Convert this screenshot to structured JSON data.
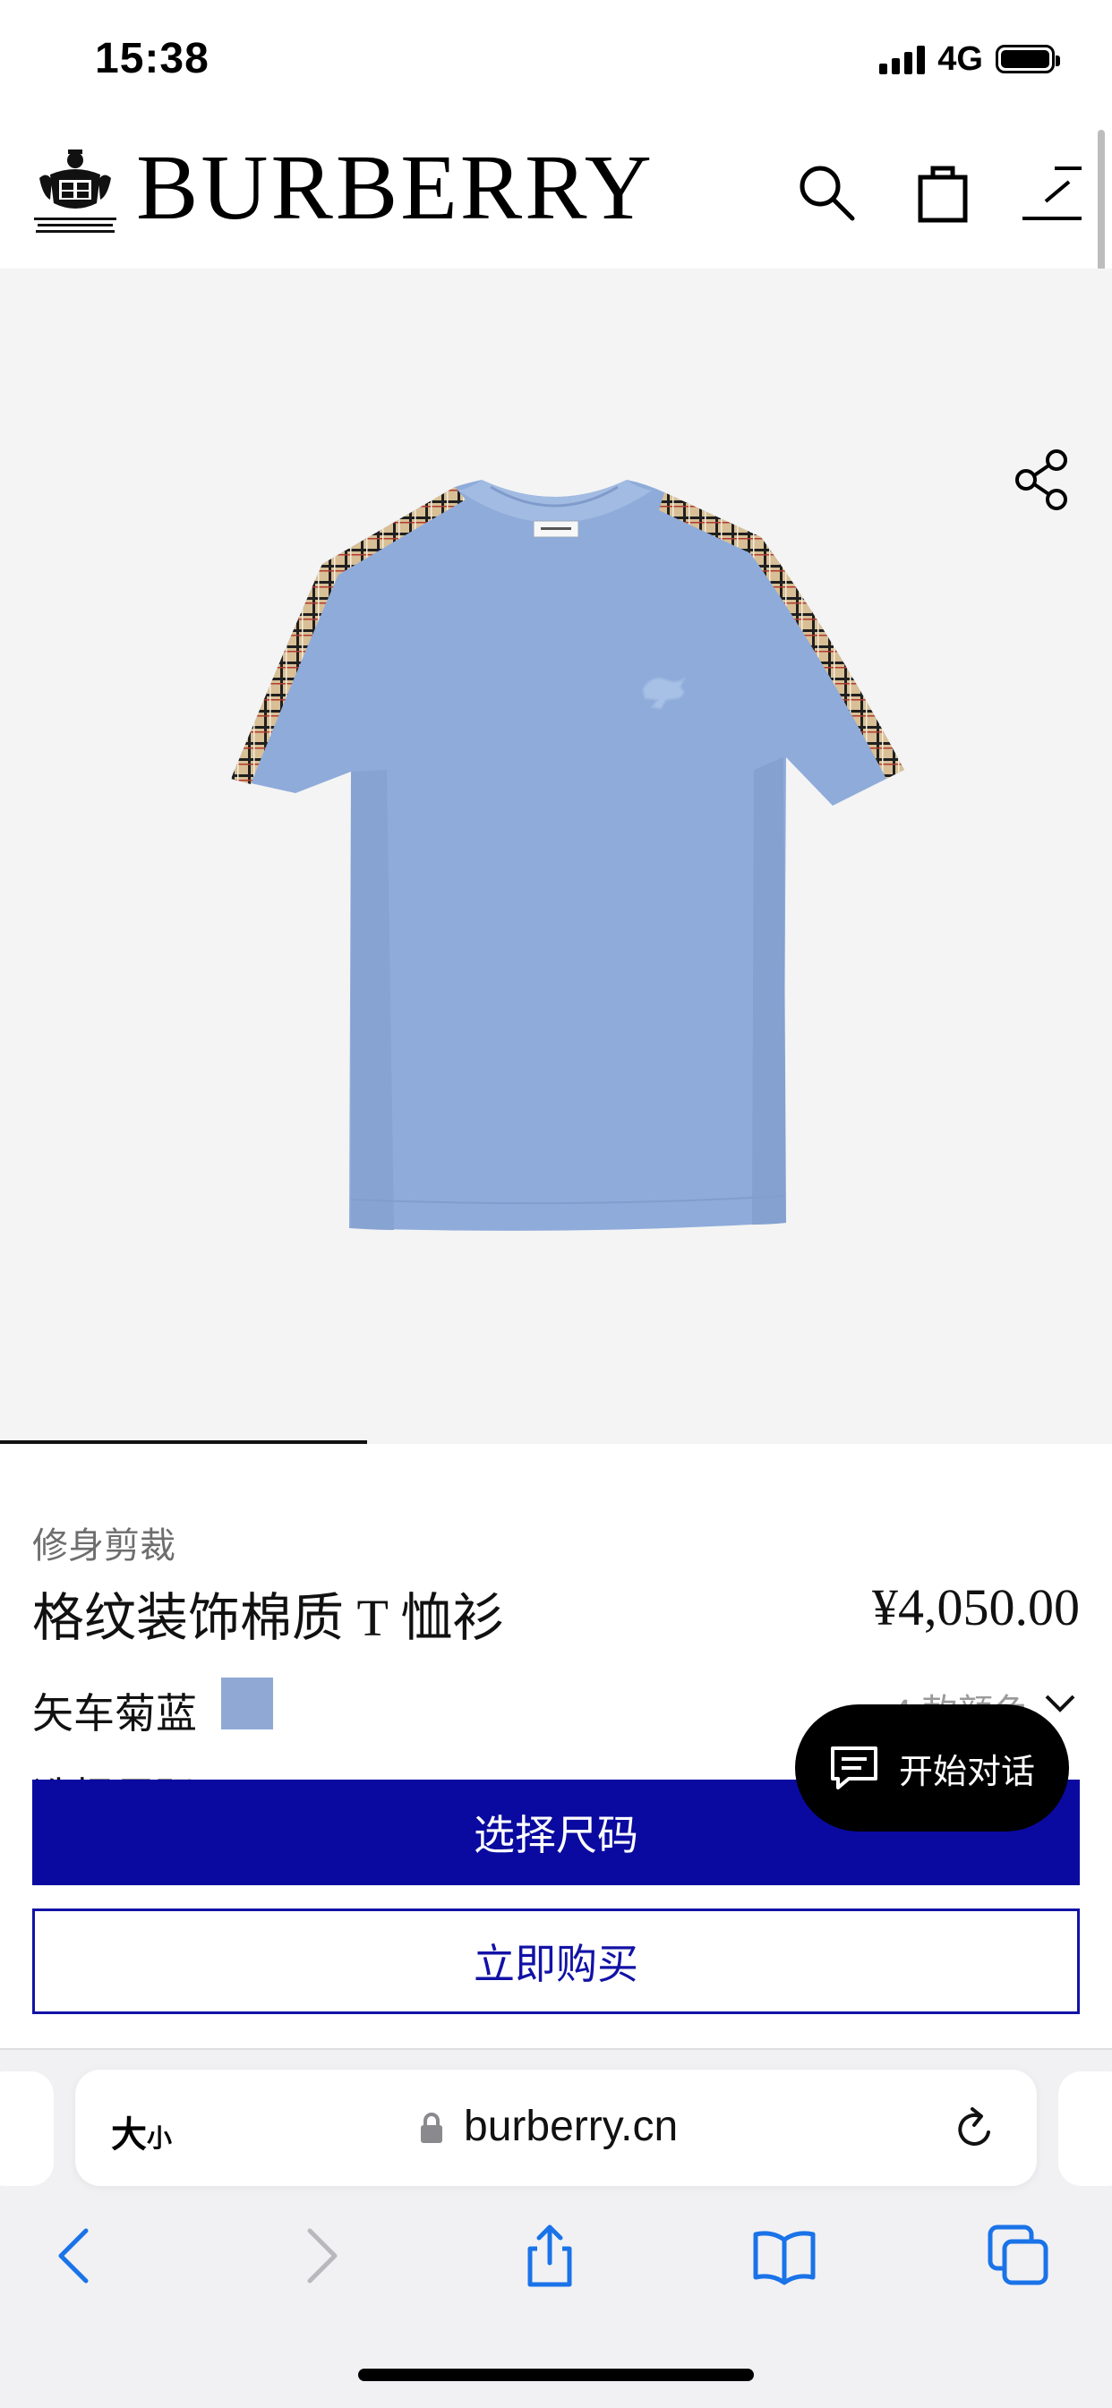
{
  "status_bar": {
    "time": "15:38",
    "network": "4G"
  },
  "header": {
    "brand": "BURBERRY"
  },
  "product": {
    "category": "修身剪裁",
    "title": "格纹装饰棉质 T 恤衫",
    "price": "¥4,050.00",
    "color_name": "矢车菊蓝",
    "swatch_color": "#8fa9d4",
    "colors_count": "4 款颜色",
    "select_size_hint": "选择尺码"
  },
  "actions": {
    "select_size": "选择尺码",
    "buy_now": "立即购买"
  },
  "chat": {
    "label": "开始对话"
  },
  "browser": {
    "text_size_big": "大",
    "text_size_small": "小",
    "url": "burberry.cn"
  },
  "colors": {
    "primary_button": "#0a0aa0",
    "tshirt": "#8eabda",
    "chat_bg": "#000000"
  }
}
